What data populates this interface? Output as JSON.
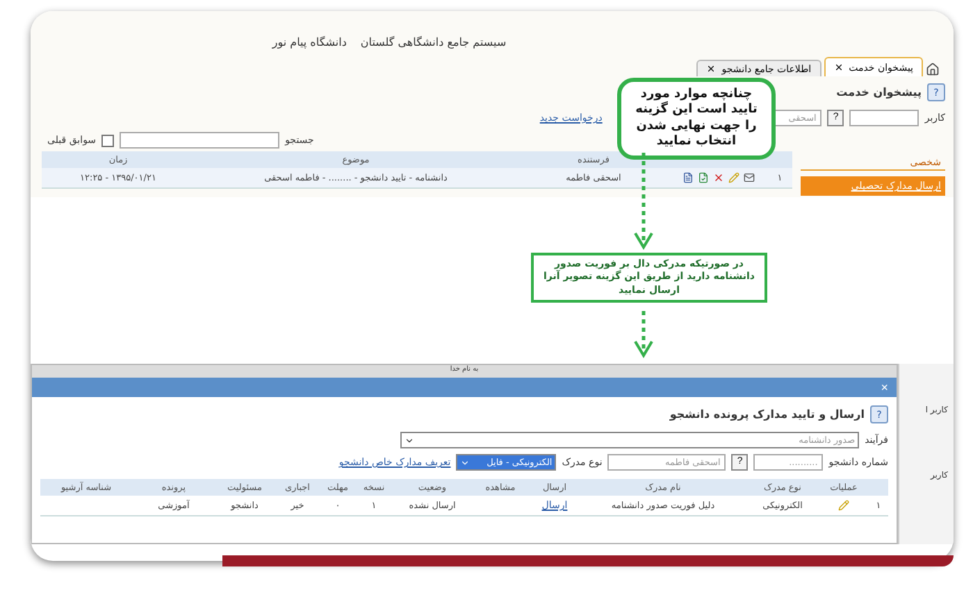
{
  "header": {
    "system_title": "سیستم جامع دانشگاهی گلستان",
    "university": "دانشگاه پیام نور"
  },
  "tabs": [
    {
      "label": "پیشخوان خدمت",
      "selected": true
    },
    {
      "label": "اطلاعات جامع دانشجو",
      "selected": false
    }
  ],
  "panel_title": "پیشخوان خدمت",
  "panel_help": "?",
  "filter": {
    "label": "کاربر",
    "help": "?",
    "user_name": "اسحقی"
  },
  "new_request_link": "درخواست جدید",
  "search": {
    "label": "جستجو"
  },
  "history_checkbox": {
    "label": "سوابق قبلی",
    "checked": false
  },
  "sidebar": [
    {
      "label": "شخصی",
      "kind": "header",
      "selected": false
    },
    {
      "label": "ارسال مدارک تحصیلی",
      "kind": "item",
      "selected": true
    }
  ],
  "inbox": {
    "columns": [
      "فرستنده",
      "موضوع",
      "زمان"
    ],
    "rows": [
      {
        "index": "۱",
        "sender": "اسحقی فاطمه",
        "subject": "دانشنامه - تایید دانشجو - ........ - فاطمه اسحقی",
        "time": "۱۳۹۵/۰۱/۲۱ - ۱۲:۲۵"
      }
    ]
  },
  "callouts": [
    {
      "kind": "bubble",
      "text": "چنانچه موارد مورد تایید است این گزینه را جهت نهایی شدن انتخاب نمایید"
    },
    {
      "kind": "box",
      "text": "در صورتیکه مدرکی دال بر فوریت صدور دانشنامه دارید از طریق این گزینه تصویر آنرا ارسال نمایید"
    }
  ],
  "dialog": {
    "title_help": "?",
    "top_caption": "به نام خدا",
    "close": "×",
    "title": "ارسال و تایید مدارک پرونده دانشجو",
    "process_label": "فرآیند",
    "process_value": "صدور دانشنامه",
    "student_no_label": "شماره دانشجو",
    "student_no_value": "..........",
    "help": "?",
    "student_name": "اسحقی فاطمه",
    "doc_type_label": "نوع مدرک",
    "doc_type_value": "الکترونیکی - فایل",
    "special_docs_link": "تعریف مدارک خاص دانشجو",
    "columns": [
      "عملیات",
      "نوع مدرک",
      "نام مدرک",
      "ارسال",
      "مشاهده",
      "وضعیت",
      "نسخه",
      "مهلت",
      "اجباری",
      "مسئولیت",
      "پرونده",
      "شناسه آرشیو"
    ],
    "rows": [
      {
        "index": "۱",
        "doc_type": "الکترونیکی",
        "doc_name": "دلیل فوریت صدور دانشنامه",
        "send_link": "ارسال",
        "status": "ارسال نشده",
        "version": "۱",
        "deadline": "۰",
        "mandatory": "خیر",
        "responsibility": "دانشجو",
        "dossier": "آموزشی"
      }
    ]
  },
  "background_labels": [
    "کاربر ا",
    "کاربر"
  ]
}
